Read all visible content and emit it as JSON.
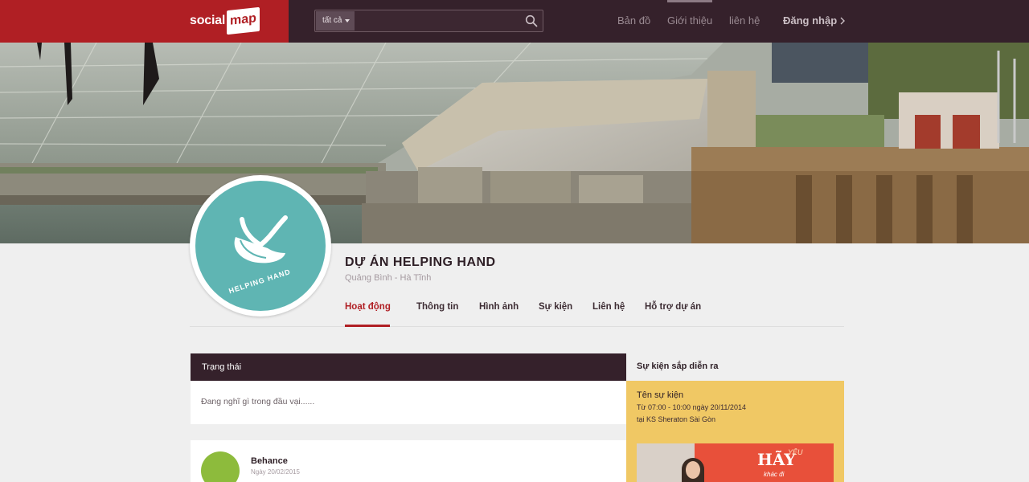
{
  "header": {
    "logo_part1": "social",
    "logo_part2": "map",
    "search": {
      "category": "tất cả",
      "placeholder": ""
    },
    "nav": [
      {
        "label": "Bản đồ"
      },
      {
        "label": "Giới thiệu"
      },
      {
        "label": "liên hệ"
      },
      {
        "label": "Đăng nhập"
      }
    ]
  },
  "profile": {
    "name": "DỰ ÁN HELPING HAND",
    "location": "Quảng Bình - Hà Tĩnh",
    "logo_text": "HELPING HAND",
    "tabs": [
      {
        "label": "Hoạt động",
        "active": true
      },
      {
        "label": "Thông tin"
      },
      {
        "label": "Hình ảnh"
      },
      {
        "label": "Sự kiện"
      },
      {
        "label": "Liên hệ"
      },
      {
        "label": "Hỗ trợ dự án"
      }
    ]
  },
  "status": {
    "title": "Trạng thái",
    "placeholder": "Đang nghĩ gì trong đầu vại......"
  },
  "post": {
    "author": "Behance",
    "date": "Ngày 20/02/2015"
  },
  "events": {
    "title": "Sự kiện sắp diễn ra",
    "card": {
      "name": "Tên sự kiện",
      "time": "Từ 07:00 - 10:00 ngày 20/11/2014",
      "location": "tại KS Sheraton Sài Gòn",
      "image_text_1": "HÃY",
      "image_text_2": "YÊU",
      "image_text_3": "khác đi"
    }
  },
  "colors": {
    "brand_red": "#b01f24",
    "nav_dark": "#35212b",
    "teal": "#5fb5b3",
    "event_yellow": "#f0c864"
  },
  "icons": [
    "search-icon",
    "chevron-right-icon",
    "caret-down-icon",
    "heart-hand-icon"
  ]
}
